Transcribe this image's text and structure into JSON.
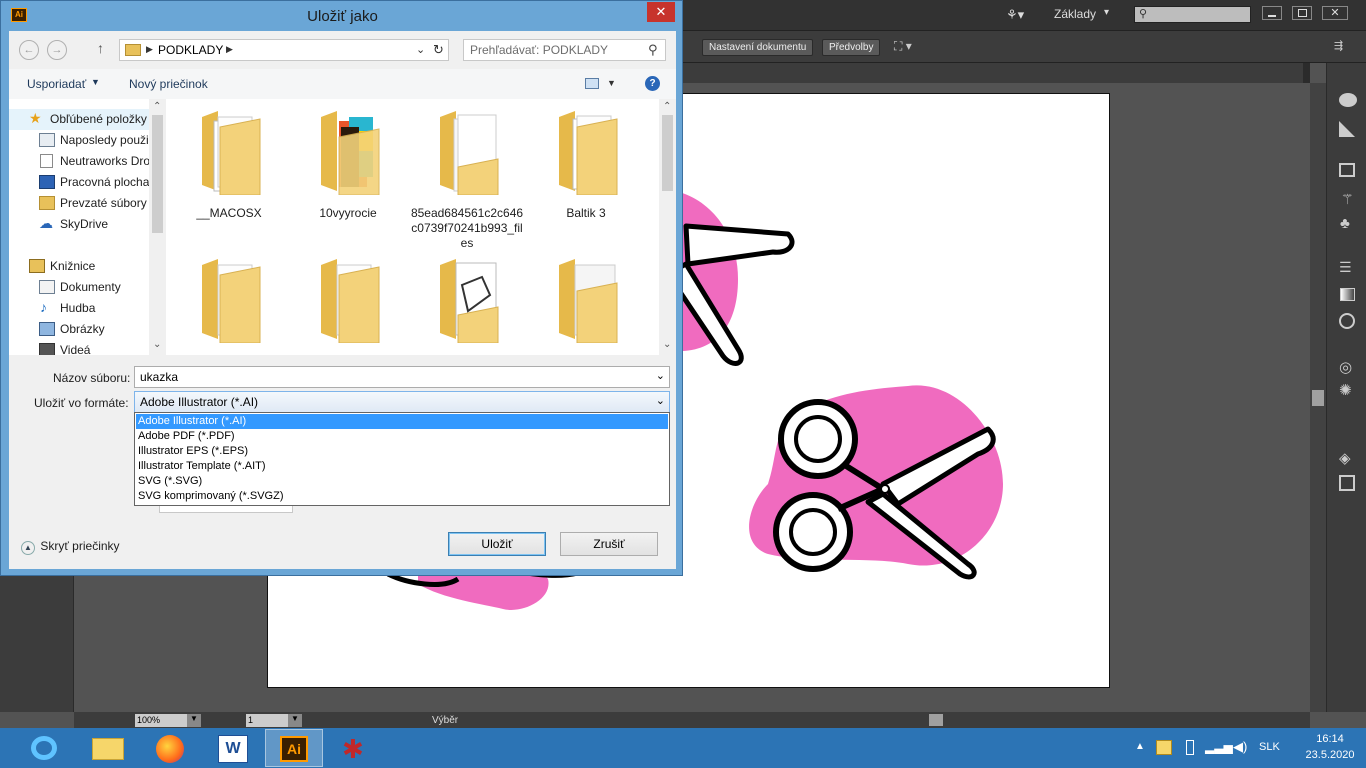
{
  "illustrator": {
    "workspace_label": "Základy",
    "doc_setup_label": "Nastavení dokumentu",
    "prefs_label": "Předvolby",
    "zoom": "100%",
    "artboard_num": "1",
    "selection_label": "Výběr"
  },
  "dialog": {
    "title": "Uložiť jako",
    "app_icon": "Ai",
    "breadcrumb": "PODKLADY",
    "search_placeholder": "Prehľadávať: PODKLADY",
    "organize_label": "Usporiadať",
    "new_folder_label": "Nový priečinok",
    "nav": {
      "favorites_label": "Obľúbené položky",
      "favorites": [
        "Naposledy použi",
        "Neutraworks Dro",
        "Pracovná plocha",
        "Prevzaté súbory",
        "SkyDrive"
      ],
      "libraries_label": "Knižnice",
      "libraries": [
        "Dokumenty",
        "Hudba",
        "Obrázky",
        "Videá"
      ]
    },
    "files": [
      "__MACOSX",
      "10vyyrocie",
      "85ead684561c2c646c0739f70241b993_files",
      "Baltik 3"
    ],
    "filename_label": "Názov súboru:",
    "filename_value": "ukazka",
    "format_label": "Uložiť vo formáte:",
    "format_value": "Adobe Illustrator (*.AI)",
    "format_options": [
      "Adobe Illustrator (*.AI)",
      "Adobe PDF (*.PDF)",
      "Illustrator EPS (*.EPS)",
      "Illustrator Template (*.AIT)",
      "SVG (*.SVG)",
      "SVG komprimovaný (*.SVGZ)"
    ],
    "hide_folders_label": "Skryť priečinky",
    "save_label": "Uložiť",
    "cancel_label": "Zrušiť"
  },
  "taskbar": {
    "language": "SLK",
    "time": "16:14",
    "date": "23.5.2020",
    "ai_label": "Ai"
  },
  "colors": {
    "accent": "#3399ff",
    "blob_pink": "#f06bbf",
    "taskbar": "#2c74b5"
  }
}
